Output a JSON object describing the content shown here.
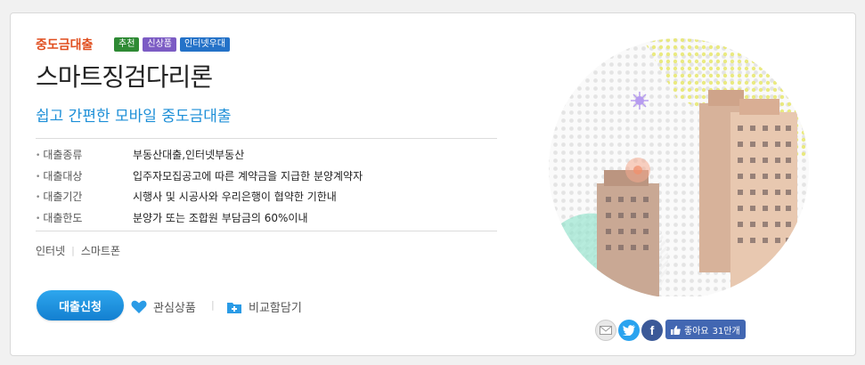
{
  "product": {
    "category": "중도금대출",
    "badges": [
      {
        "label": "추천",
        "color": "#2e8a34"
      },
      {
        "label": "신상품",
        "color": "#7c5cc4"
      },
      {
        "label": "인터넷우대",
        "color": "#2472c8"
      }
    ],
    "title": "스마트징검다리론",
    "subtitle": "쉽고 간편한 모바일 중도금대출"
  },
  "info": [
    {
      "label": "대출종류",
      "value": "부동산대출,인터넷부동산"
    },
    {
      "label": "대출대상",
      "value": "입주자모집공고에 따른 계약금을 지급한 분양계약자"
    },
    {
      "label": "대출기간",
      "value": "시행사 및 시공사와 우리은행이 협약한 기한내"
    },
    {
      "label": "대출한도",
      "value": "분양가 또는 조합원 부담금의 60%이내"
    }
  ],
  "channels": [
    "인터넷",
    "스마트폰"
  ],
  "actions": {
    "apply": "대출신청",
    "wishlist": "관심상품",
    "compare": "비교함담기"
  },
  "social": {
    "icons": [
      "mail-icon",
      "twitter-icon",
      "facebook-icon"
    ],
    "like_label": "좋아요",
    "like_count": "31만개"
  },
  "colors": {
    "category": "#e04e1f",
    "subtitle": "#1d8fd7",
    "button": "#1d8fd7"
  }
}
